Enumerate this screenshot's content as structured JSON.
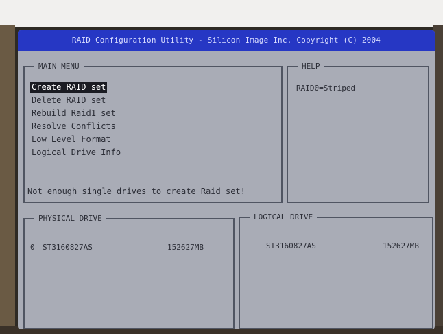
{
  "title_bar": {
    "text": "RAID Configuration Utility - Silicon Image Inc. Copyright (C) 2004"
  },
  "main_menu": {
    "title": "MAIN MENU",
    "items": [
      {
        "label": "Create RAID set",
        "selected": true
      },
      {
        "label": "Delete RAID set",
        "selected": false
      },
      {
        "label": "Rebuild Raid1 set",
        "selected": false
      },
      {
        "label": "Resolve Conflicts",
        "selected": false
      },
      {
        "label": "Low Level Format",
        "selected": false
      },
      {
        "label": "Logical Drive Info",
        "selected": false
      }
    ],
    "status": "Not enough single drives to create Raid set!"
  },
  "help": {
    "title": "HELP",
    "text": "RAID0=Striped"
  },
  "physical_drive": {
    "title": "PHYSICAL DRIVE",
    "drives": [
      {
        "index": "0",
        "model": "ST3160827AS",
        "size": "152627MB"
      }
    ]
  },
  "logical_drive": {
    "title": "LOGICAL DRIVE",
    "drives": [
      {
        "model": "ST3160827AS",
        "size": "152627MB"
      }
    ]
  },
  "colors": {
    "title_bar_bg": "#2637c4",
    "screen_bg": "#a9acb6",
    "highlight_bg": "#1a1b22"
  }
}
